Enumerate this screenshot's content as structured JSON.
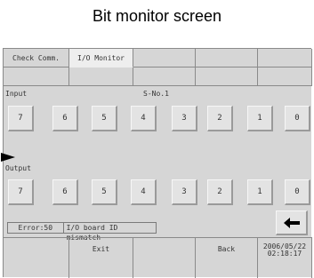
{
  "caption": "Bit monitor screen",
  "tabs": [
    {
      "label": "Check Comm.",
      "active": false
    },
    {
      "label": "I/O Monitor",
      "active": true
    },
    {
      "label": "",
      "active": false
    },
    {
      "label": "",
      "active": false
    },
    {
      "label": "",
      "active": false
    }
  ],
  "input_label": "Input",
  "station_label": "S-No.1",
  "output_label": "Output",
  "input_bits": [
    "7",
    "6",
    "5",
    "4",
    "3",
    "2",
    "1",
    "0"
  ],
  "output_bits": [
    "7",
    "6",
    "5",
    "4",
    "3",
    "2",
    "1",
    "0"
  ],
  "status": {
    "error": "Error:50",
    "message": "I/O board ID mismatch"
  },
  "back_arrow_icon": "left-arrow-icon",
  "bottom": {
    "exit": "Exit",
    "back": "Back",
    "date": "2006/05/22",
    "time": "02:18:17"
  }
}
